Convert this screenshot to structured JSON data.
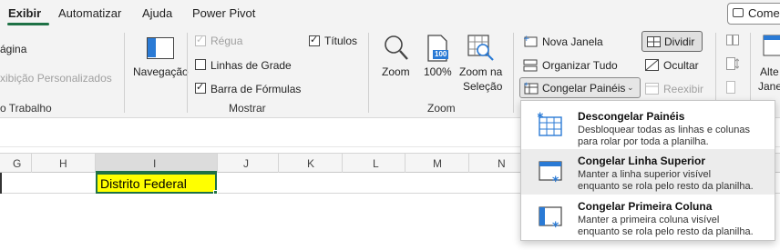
{
  "tabs": [
    {
      "label": "Exibir",
      "active": true
    },
    {
      "label": "Automatizar"
    },
    {
      "label": "Ajuda"
    },
    {
      "label": "Power Pivot"
    }
  ],
  "comments_button": "Comer",
  "ribbon": {
    "left_cut": {
      "pagina": "ágina",
      "personalizados": "xibição Personalizados",
      "trabalho": "o Trabalho"
    },
    "navegacao": "Navegação",
    "mostrar": {
      "regua": "Régua",
      "linhas_grade": "Linhas de Grade",
      "barra_formulas": "Barra de Fórmulas",
      "titulos": "Títulos",
      "group_label": "Mostrar"
    },
    "zoom": {
      "zoom": "Zoom",
      "pct": "100%",
      "zoom_selecao_1": "Zoom na",
      "zoom_selecao_2": "Seleção",
      "group_label": "Zoom",
      "icon_100": "100"
    },
    "janela": {
      "nova_janela": "Nova Janela",
      "organizar_tudo": "Organizar Tudo",
      "congelar_paineis": "Congelar Painéis",
      "dividir": "Dividir",
      "ocultar": "Ocultar",
      "reexibir": "Reexibir",
      "alte": "Alte",
      "jane": "Jane"
    }
  },
  "columns": [
    "G",
    "H",
    "I",
    "J",
    "K",
    "L",
    "M",
    "N"
  ],
  "selected_cell": {
    "value": "Distrito Federal",
    "fill": "#ffff00"
  },
  "freeze_menu": [
    {
      "title": "Descongelar Painéis",
      "desc1": "Desbloquear todas as linhas e colunas",
      "desc2": "para rolar por toda a planilha."
    },
    {
      "title": "Congelar Linha Superior",
      "desc1": "Manter a linha superior visível",
      "desc2": "enquanto se rola pelo resto da planilha."
    },
    {
      "title": "Congelar Primeira Coluna",
      "desc1": "Manter a primeira coluna visível",
      "desc2": "enquanto se rola pelo resto da planilha."
    }
  ],
  "accent_color": "#1e7145",
  "icon_color": "#2a7ad5"
}
